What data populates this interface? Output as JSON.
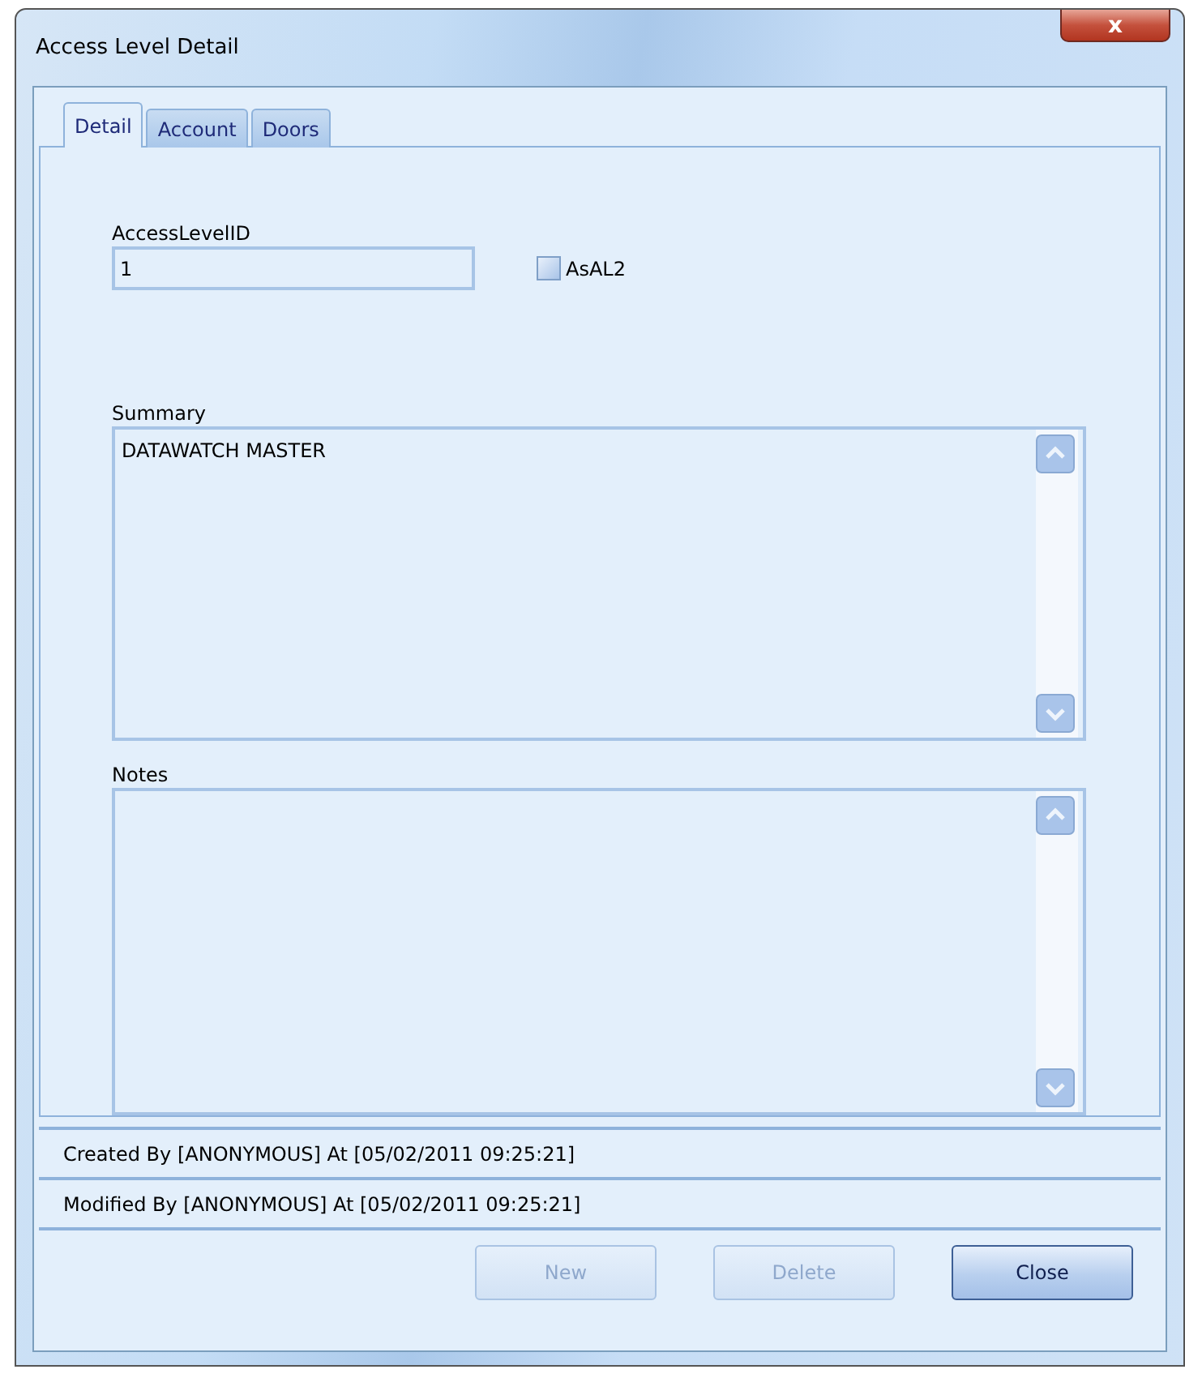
{
  "window": {
    "title": "Access Level Detail",
    "close_glyph": "x"
  },
  "tabs": [
    {
      "label": "Detail",
      "selected": true
    },
    {
      "label": "Account",
      "selected": false
    },
    {
      "label": "Doors",
      "selected": false
    }
  ],
  "access_level_id": {
    "label": "AccessLevelID",
    "value": "1"
  },
  "as_al2": {
    "label": "AsAL2",
    "checked": false
  },
  "summary": {
    "label": "Summary",
    "value": "DATAWATCH MASTER"
  },
  "notes": {
    "label": "Notes"
  },
  "status": [
    "Created By [ANONYMOUS] At [05/02/2011 09:25:21]",
    "Modified By [ANONYMOUS] At [05/02/2011 09:25:21]"
  ],
  "buttons": [
    {
      "label": "New",
      "disabled": true
    },
    {
      "label": "Delete",
      "disabled": true
    },
    {
      "label": "Close",
      "disabled": false
    }
  ]
}
